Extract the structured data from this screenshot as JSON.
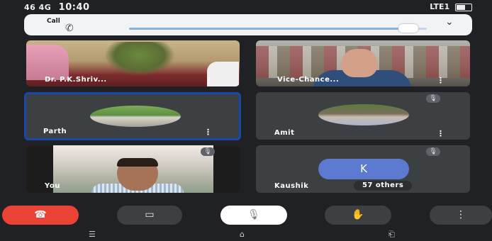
{
  "status_bar": {
    "left_text": "46 4G",
    "time": "10:40",
    "right_text": "LTE1"
  },
  "call_bar": {
    "label": "Call",
    "volume_fraction": 0.93
  },
  "tiles": [
    {
      "name": "Dr. P.K.Shriv..."
    },
    {
      "name": "Vice-Chance..."
    },
    {
      "name": "Parth"
    },
    {
      "name": "Amit"
    },
    {
      "name": "You"
    },
    {
      "name": "Kaushik",
      "initial": "K",
      "others_label": "57 others"
    }
  ],
  "controls": {
    "end_call_icon": "hang-up-icon",
    "camera_icon": "camera-icon",
    "mic_icon": "mic-off-icon",
    "raise_hand_icon": "hand-icon",
    "more_icon": "kebab-icon"
  },
  "colors": {
    "background": "#202124",
    "end_call": "#ea4335",
    "tile": "#3c4043",
    "selected_border": "#1a47a8",
    "avatar_k": "#5c7ad0"
  }
}
